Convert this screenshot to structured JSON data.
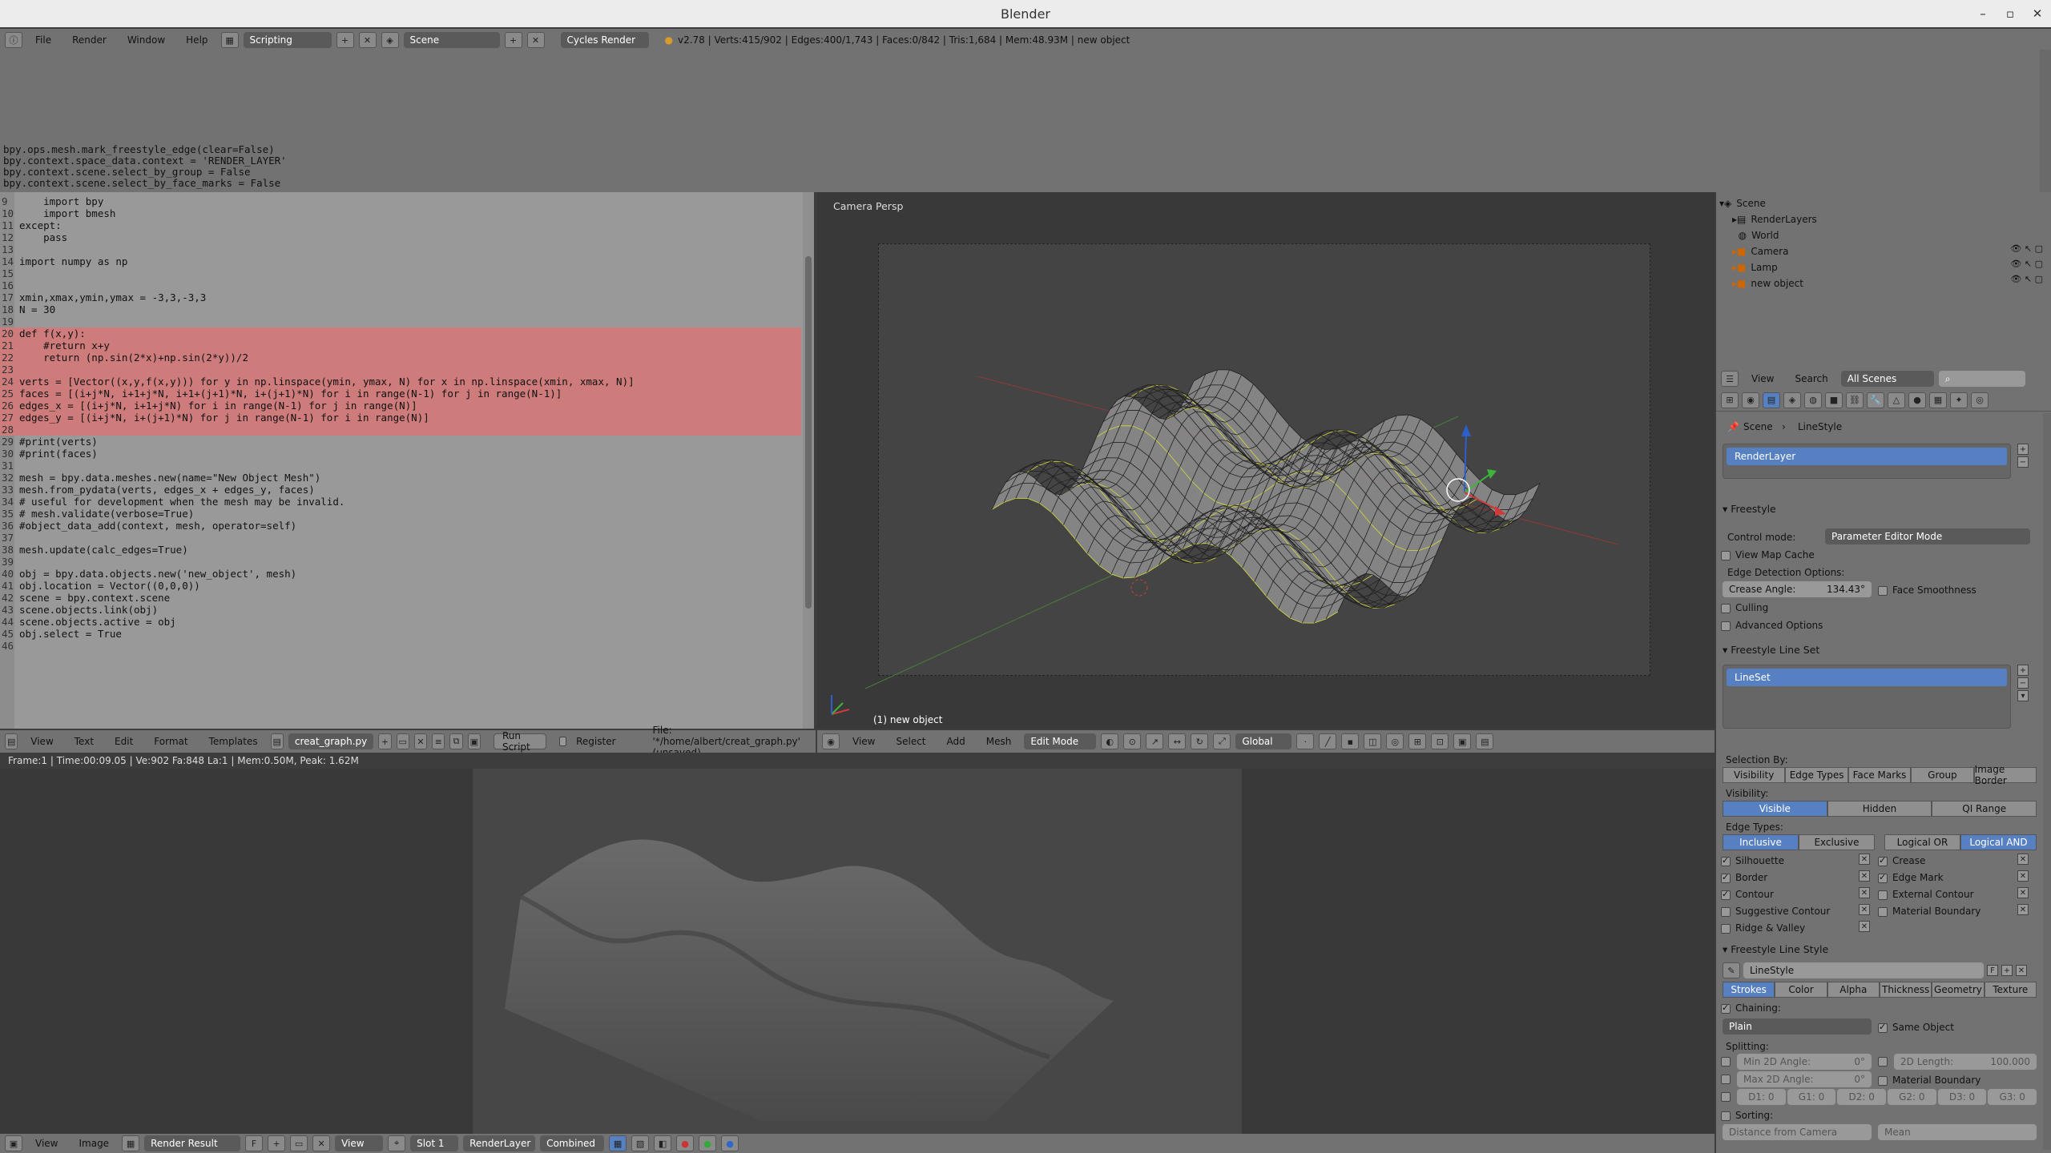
{
  "window": {
    "title": "Blender",
    "controls": [
      "–",
      "▫",
      "✕"
    ]
  },
  "topbar": {
    "menus": [
      "File",
      "Render",
      "Window",
      "Help"
    ],
    "layout": "Scripting",
    "scene": "Scene",
    "engine": "Cycles Render",
    "stats": "v2.78 | Verts:415/902 | Edges:400/1,743 | Faces:0/842 | Tris:1,684 | Mem:48.93M | new object"
  },
  "info": {
    "lines": [
      "bpy.ops.mesh.mark_freestyle_edge(clear=False)",
      "bpy.context.space_data.context = 'RENDER_LAYER'",
      "bpy.context.scene.select_by_group = False",
      "bpy.context.scene.select_by_face_marks = False"
    ]
  },
  "code": {
    "lines": [
      {
        "n": "9",
        "t": "    import bpy",
        "hl": false
      },
      {
        "n": "10",
        "t": "    import bmesh",
        "hl": false
      },
      {
        "n": "11",
        "t": "except:",
        "hl": false
      },
      {
        "n": "12",
        "t": "    pass",
        "hl": false
      },
      {
        "n": "13",
        "t": "",
        "hl": false
      },
      {
        "n": "14",
        "t": "import numpy as np",
        "hl": false
      },
      {
        "n": "15",
        "t": "",
        "hl": false
      },
      {
        "n": "16",
        "t": "",
        "hl": false
      },
      {
        "n": "17",
        "t": "xmin,xmax,ymin,ymax = -3,3,-3,3",
        "hl": false
      },
      {
        "n": "18",
        "t": "N = 30",
        "hl": false
      },
      {
        "n": "19",
        "t": "",
        "hl": false
      },
      {
        "n": "20",
        "t": "def f(x,y):",
        "hl": true
      },
      {
        "n": "21",
        "t": "    #return x+y",
        "hl": true
      },
      {
        "n": "22",
        "t": "    return (np.sin(2*x)+np.sin(2*y))/2",
        "hl": true
      },
      {
        "n": "23",
        "t": "",
        "hl": true
      },
      {
        "n": "24",
        "t": "verts = [Vector((x,y,f(x,y))) for y in np.linspace(ymin, ymax, N) for x in np.linspace(xmin, xmax, N)]",
        "hl": true
      },
      {
        "n": "25",
        "t": "faces = [(i+j*N, i+1+j*N, i+1+(j+1)*N, i+(j+1)*N) for i in range(N-1) for j in range(N-1)]",
        "hl": true
      },
      {
        "n": "26",
        "t": "edges_x = [(i+j*N, i+1+j*N) for i in range(N-1) for j in range(N)]",
        "hl": true
      },
      {
        "n": "27",
        "t": "edges_y = [(i+j*N, i+(j+1)*N) for j in range(N-1) for i in range(N)]",
        "hl": true
      },
      {
        "n": "28",
        "t": "",
        "hl": true
      },
      {
        "n": "29",
        "t": "#print(verts)",
        "hl": false
      },
      {
        "n": "30",
        "t": "#print(faces)",
        "hl": false
      },
      {
        "n": "31",
        "t": "",
        "hl": false
      },
      {
        "n": "32",
        "t": "mesh = bpy.data.meshes.new(name=\"New Object Mesh\")",
        "hl": false
      },
      {
        "n": "33",
        "t": "mesh.from_pydata(verts, edges_x + edges_y, faces)",
        "hl": false
      },
      {
        "n": "34",
        "t": "# useful for development when the mesh may be invalid.",
        "hl": false
      },
      {
        "n": "35",
        "t": "# mesh.validate(verbose=True)",
        "hl": false
      },
      {
        "n": "36",
        "t": "#object_data_add(context, mesh, operator=self)",
        "hl": false
      },
      {
        "n": "37",
        "t": "",
        "hl": false
      },
      {
        "n": "38",
        "t": "mesh.update(calc_edges=True)",
        "hl": false
      },
      {
        "n": "39",
        "t": "",
        "hl": false
      },
      {
        "n": "40",
        "t": "obj = bpy.data.objects.new('new_object', mesh)",
        "hl": false
      },
      {
        "n": "41",
        "t": "obj.location = Vector((0,0,0))",
        "hl": false
      },
      {
        "n": "42",
        "t": "scene = bpy.context.scene",
        "hl": false
      },
      {
        "n": "43",
        "t": "scene.objects.link(obj)",
        "hl": false
      },
      {
        "n": "44",
        "t": "scene.objects.active = obj",
        "hl": false
      },
      {
        "n": "45",
        "t": "obj.select = True",
        "hl": false
      },
      {
        "n": "46",
        "t": "",
        "hl": false
      }
    ]
  },
  "texteditor_header": {
    "menus": [
      "View",
      "Text",
      "Edit",
      "Format",
      "Templates"
    ],
    "filename": "creat_graph.py",
    "run": "Run Script",
    "register": "Register",
    "file": "File: '*/home/albert/creat_graph.py' (unsaved)"
  },
  "viewport": {
    "label": "Camera Persp",
    "object_label": "(1) new object",
    "header_menus": [
      "View",
      "Select",
      "Add",
      "Mesh"
    ],
    "mode": "Edit Mode",
    "orientation": "Global"
  },
  "render_status": "Frame:1 | Time:00:09.05 | Ve:902 Fa:848 La:1 | Mem:0.50M, Peak: 1.62M",
  "image_header": {
    "menus": [
      "View",
      "Image"
    ],
    "image": "Render Result",
    "fake": "F",
    "view": "View",
    "slot": "Slot 1",
    "layer": "RenderLayer",
    "pass": "Combined"
  },
  "outliner": {
    "items": [
      "Scene",
      "RenderLayers",
      "World",
      "Camera",
      "Lamp",
      "new object"
    ],
    "header_menus": [
      "View",
      "Search"
    ],
    "filter": "All Scenes"
  },
  "properties": {
    "breadcrumb": [
      "Scene",
      "LineStyle"
    ],
    "renderlayer": "RenderLayer",
    "freestyle": "Freestyle",
    "control_mode_label": "Control mode:",
    "control_mode": "Parameter Editor Mode",
    "view_map_cache": "View Map Cache",
    "edge_detection": "Edge Detection Options:",
    "crease_angle_label": "Crease Angle:",
    "crease_angle": "134.43°",
    "face_smoothness": "Face Smoothness",
    "culling": "Culling",
    "advanced": "Advanced Options",
    "lineset_head": "Freestyle Line Set",
    "lineset": "LineSet",
    "selection_by": "Selection By:",
    "selection_tabs": [
      "Visibility",
      "Edge Types",
      "Face Marks",
      "Group",
      "Image Border"
    ],
    "visibility_label": "Visibility:",
    "visibility_tabs": [
      "Visible",
      "Hidden",
      "QI Range"
    ],
    "edge_types_label": "Edge Types:",
    "incl_tabs": [
      "Inclusive",
      "Exclusive"
    ],
    "logic_tabs": [
      "Logical OR",
      "Logical AND"
    ],
    "edge_left": [
      "Silhouette",
      "Border",
      "Contour",
      "Suggestive Contour",
      "Ridge & Valley"
    ],
    "edge_right": [
      "Crease",
      "Edge Mark",
      "External Contour",
      "Material Boundary"
    ],
    "linestyle_head": "Freestyle Line Style",
    "linestyle": "LineStyle",
    "linestyle_fake": "F",
    "style_tabs": [
      "Strokes",
      "Color",
      "Alpha",
      "Thickness",
      "Geometry",
      "Texture"
    ],
    "chaining": "Chaining:",
    "chain_type": "Plain",
    "same_object": "Same Object",
    "splitting": "Splitting:",
    "min2d": "Min 2D Angle:",
    "min2d_val": "0°",
    "len2d": "2D Length:",
    "len2d_val": "100.000",
    "max2d": "Max 2D Angle:",
    "max2d_val": "0°",
    "mat_boundary": "Material Boundary",
    "dash_fields": [
      "D1: 0",
      "G1: 0",
      "D2: 0",
      "G2: 0",
      "D3: 0",
      "G3: 0"
    ],
    "sorting": "Sorting:",
    "sort_key": "Distance from Camera",
    "sort_mode": "Mean"
  }
}
